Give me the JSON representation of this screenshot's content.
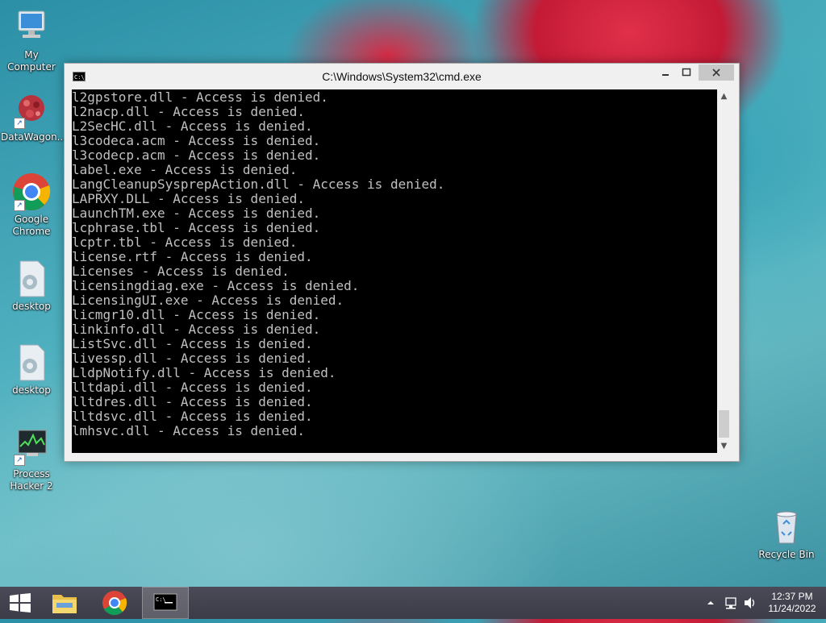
{
  "desktop": {
    "icons": [
      {
        "label": "My Computer"
      },
      {
        "label": "DataWagon..."
      },
      {
        "label": "Google Chrome"
      },
      {
        "label": "desktop"
      },
      {
        "label": "desktop"
      },
      {
        "label": "Process Hacker 2"
      },
      {
        "label": "Recycle Bin"
      }
    ]
  },
  "window": {
    "title": "C:\\Windows\\System32\\cmd.exe",
    "icon": "cmd-icon",
    "console_lines": [
      "l2gpstore.dll - Access is denied.",
      "l2nacp.dll - Access is denied.",
      "L2SecHC.dll - Access is denied.",
      "l3codeca.acm - Access is denied.",
      "l3codecp.acm - Access is denied.",
      "label.exe - Access is denied.",
      "LangCleanupSysprepAction.dll - Access is denied.",
      "LAPRXY.DLL - Access is denied.",
      "LaunchTM.exe - Access is denied.",
      "lcphrase.tbl - Access is denied.",
      "lcptr.tbl - Access is denied.",
      "license.rtf - Access is denied.",
      "Licenses - Access is denied.",
      "licensingdiag.exe - Access is denied.",
      "LicensingUI.exe - Access is denied.",
      "licmgr10.dll - Access is denied.",
      "linkinfo.dll - Access is denied.",
      "ListSvc.dll - Access is denied.",
      "livessp.dll - Access is denied.",
      "LldpNotify.dll - Access is denied.",
      "lltdapi.dll - Access is denied.",
      "lltdres.dll - Access is denied.",
      "lltdsvc.dll - Access is denied.",
      "lmhsvc.dll - Access is denied."
    ]
  },
  "taskbar": {
    "clock_time": "12:37 PM",
    "clock_date": "11/24/2022"
  }
}
